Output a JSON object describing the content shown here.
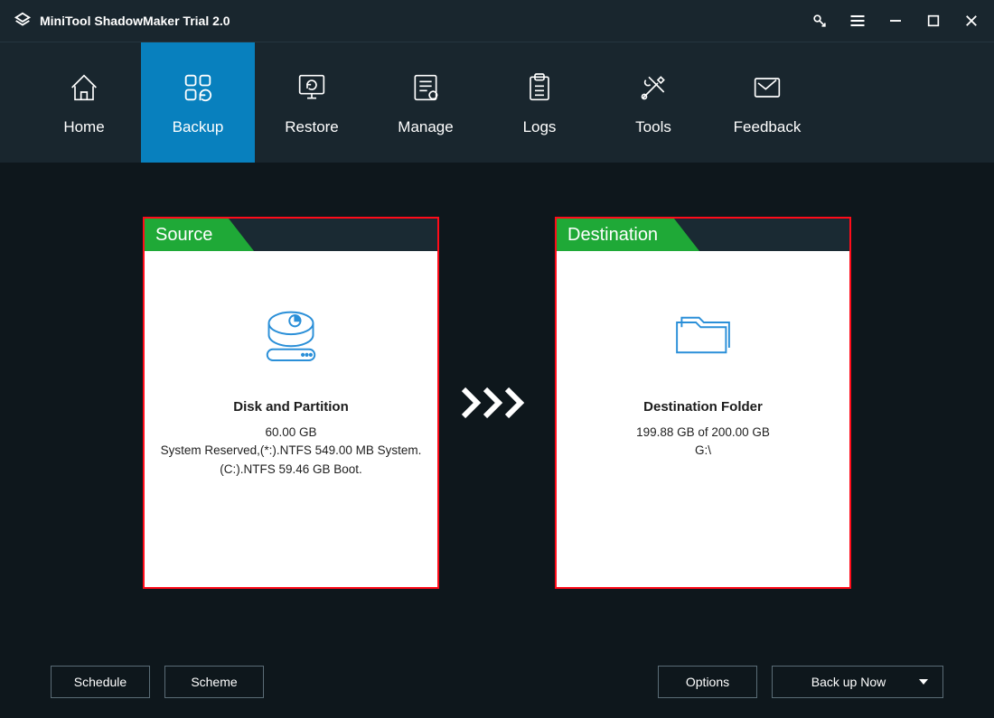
{
  "app": {
    "title": "MiniTool ShadowMaker Trial 2.0"
  },
  "nav": {
    "items": [
      {
        "label": "Home"
      },
      {
        "label": "Backup"
      },
      {
        "label": "Restore"
      },
      {
        "label": "Manage"
      },
      {
        "label": "Logs"
      },
      {
        "label": "Tools"
      },
      {
        "label": "Feedback"
      }
    ]
  },
  "source": {
    "tab": "Source",
    "title": "Disk and Partition",
    "size": "60.00 GB",
    "details1": "System Reserved,(*:).NTFS 549.00 MB System.",
    "details2": "(C:).NTFS 59.46 GB Boot."
  },
  "destination": {
    "tab": "Destination",
    "title": "Destination Folder",
    "size": "199.88 GB of 200.00 GB",
    "path": "G:\\"
  },
  "buttons": {
    "schedule": "Schedule",
    "scheme": "Scheme",
    "options": "Options",
    "backup": "Back up Now"
  }
}
